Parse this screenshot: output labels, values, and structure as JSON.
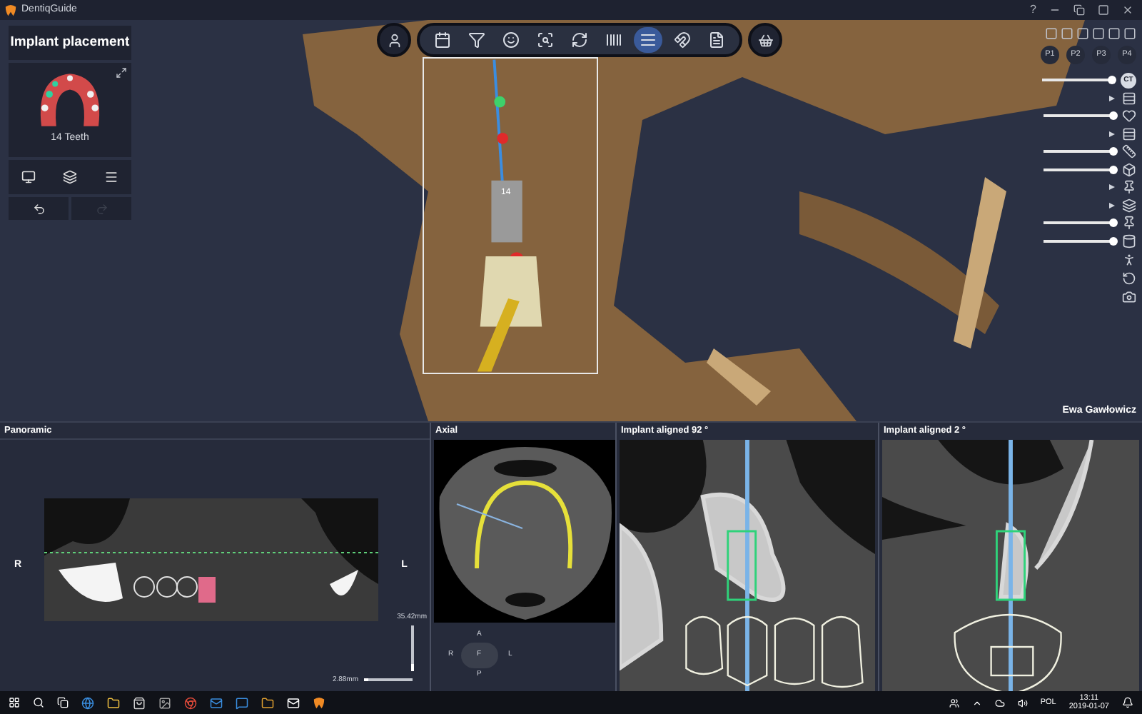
{
  "window": {
    "title": "DentiqGuide",
    "help": "?"
  },
  "left_panel": {
    "title": "Implant placement",
    "teeth_label": "14 Teeth",
    "undo": {
      "disabled": false
    },
    "redo": {
      "disabled": true
    }
  },
  "toolbar": {
    "tools": [
      {
        "selected": false
      },
      {
        "selected": false
      },
      {
        "selected": false
      },
      {
        "selected": false
      },
      {
        "selected": false
      },
      {
        "selected": false
      },
      {
        "selected": true
      },
      {
        "selected": false
      },
      {
        "selected": false
      }
    ]
  },
  "implant_label": "14",
  "presets": [
    "P1",
    "P2",
    "P3",
    "P4"
  ],
  "view_controls": [
    {
      "kind": "slider",
      "level": 0.97,
      "label": "CT"
    },
    {
      "kind": "toggle"
    },
    {
      "kind": "slider",
      "level": 0.97
    },
    {
      "kind": "toggle"
    },
    {
      "kind": "slider",
      "level": 0.97
    },
    {
      "kind": "slider",
      "level": 0.97
    },
    {
      "kind": "toggle"
    },
    {
      "kind": "toggle"
    },
    {
      "kind": "slider",
      "level": 0.97
    },
    {
      "kind": "slider",
      "level": 0.97
    }
  ],
  "patient_name": "Ewa Gawłowicz",
  "panoramic": {
    "title": "Panoramic",
    "left_side": "R",
    "right_side": "L",
    "thickness_slider": {
      "value": "35.42mm",
      "level": 0.15
    },
    "zoom_slider": {
      "value": "2.88mm",
      "level": 0.1
    }
  },
  "axial": {
    "title": "Axial",
    "orientation": [
      "A",
      "R",
      "F",
      "L",
      "P"
    ]
  },
  "cross_sections": [
    {
      "title": "Implant aligned 92 °"
    },
    {
      "title": "Implant aligned 2 °"
    }
  ],
  "taskbar": {
    "language": "POL",
    "time": "13:11",
    "date": "2019-01-07"
  }
}
